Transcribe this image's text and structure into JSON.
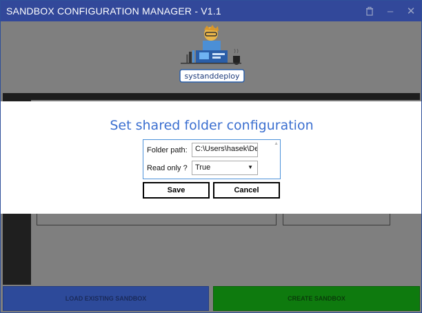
{
  "window": {
    "title": "SANDBOX CONFIGURATION MANAGER - V1.1",
    "icons": [
      "trash-icon",
      "minimize-icon",
      "close-icon"
    ],
    "minimize_glyph": "–",
    "close_glyph": "✕"
  },
  "logo": {
    "text": "systanddeploy"
  },
  "dialog": {
    "title": "Set shared folder configuration",
    "folder_path_label": "Folder path:",
    "folder_path_value": "C:\\Users\\hasek\\Des",
    "read_only_label": "Read only ?",
    "read_only_value": "True",
    "save_label": "Save",
    "cancel_label": "Cancel"
  },
  "footer": {
    "load_label": "LOAD EXISTING SANDBOX",
    "create_label": "CREATE SANDBOX"
  },
  "colors": {
    "titlebar": "#32489a",
    "dialog_title": "#3b6fd0",
    "load_button": "#2d4a9a",
    "create_button": "#0e7a0e"
  }
}
